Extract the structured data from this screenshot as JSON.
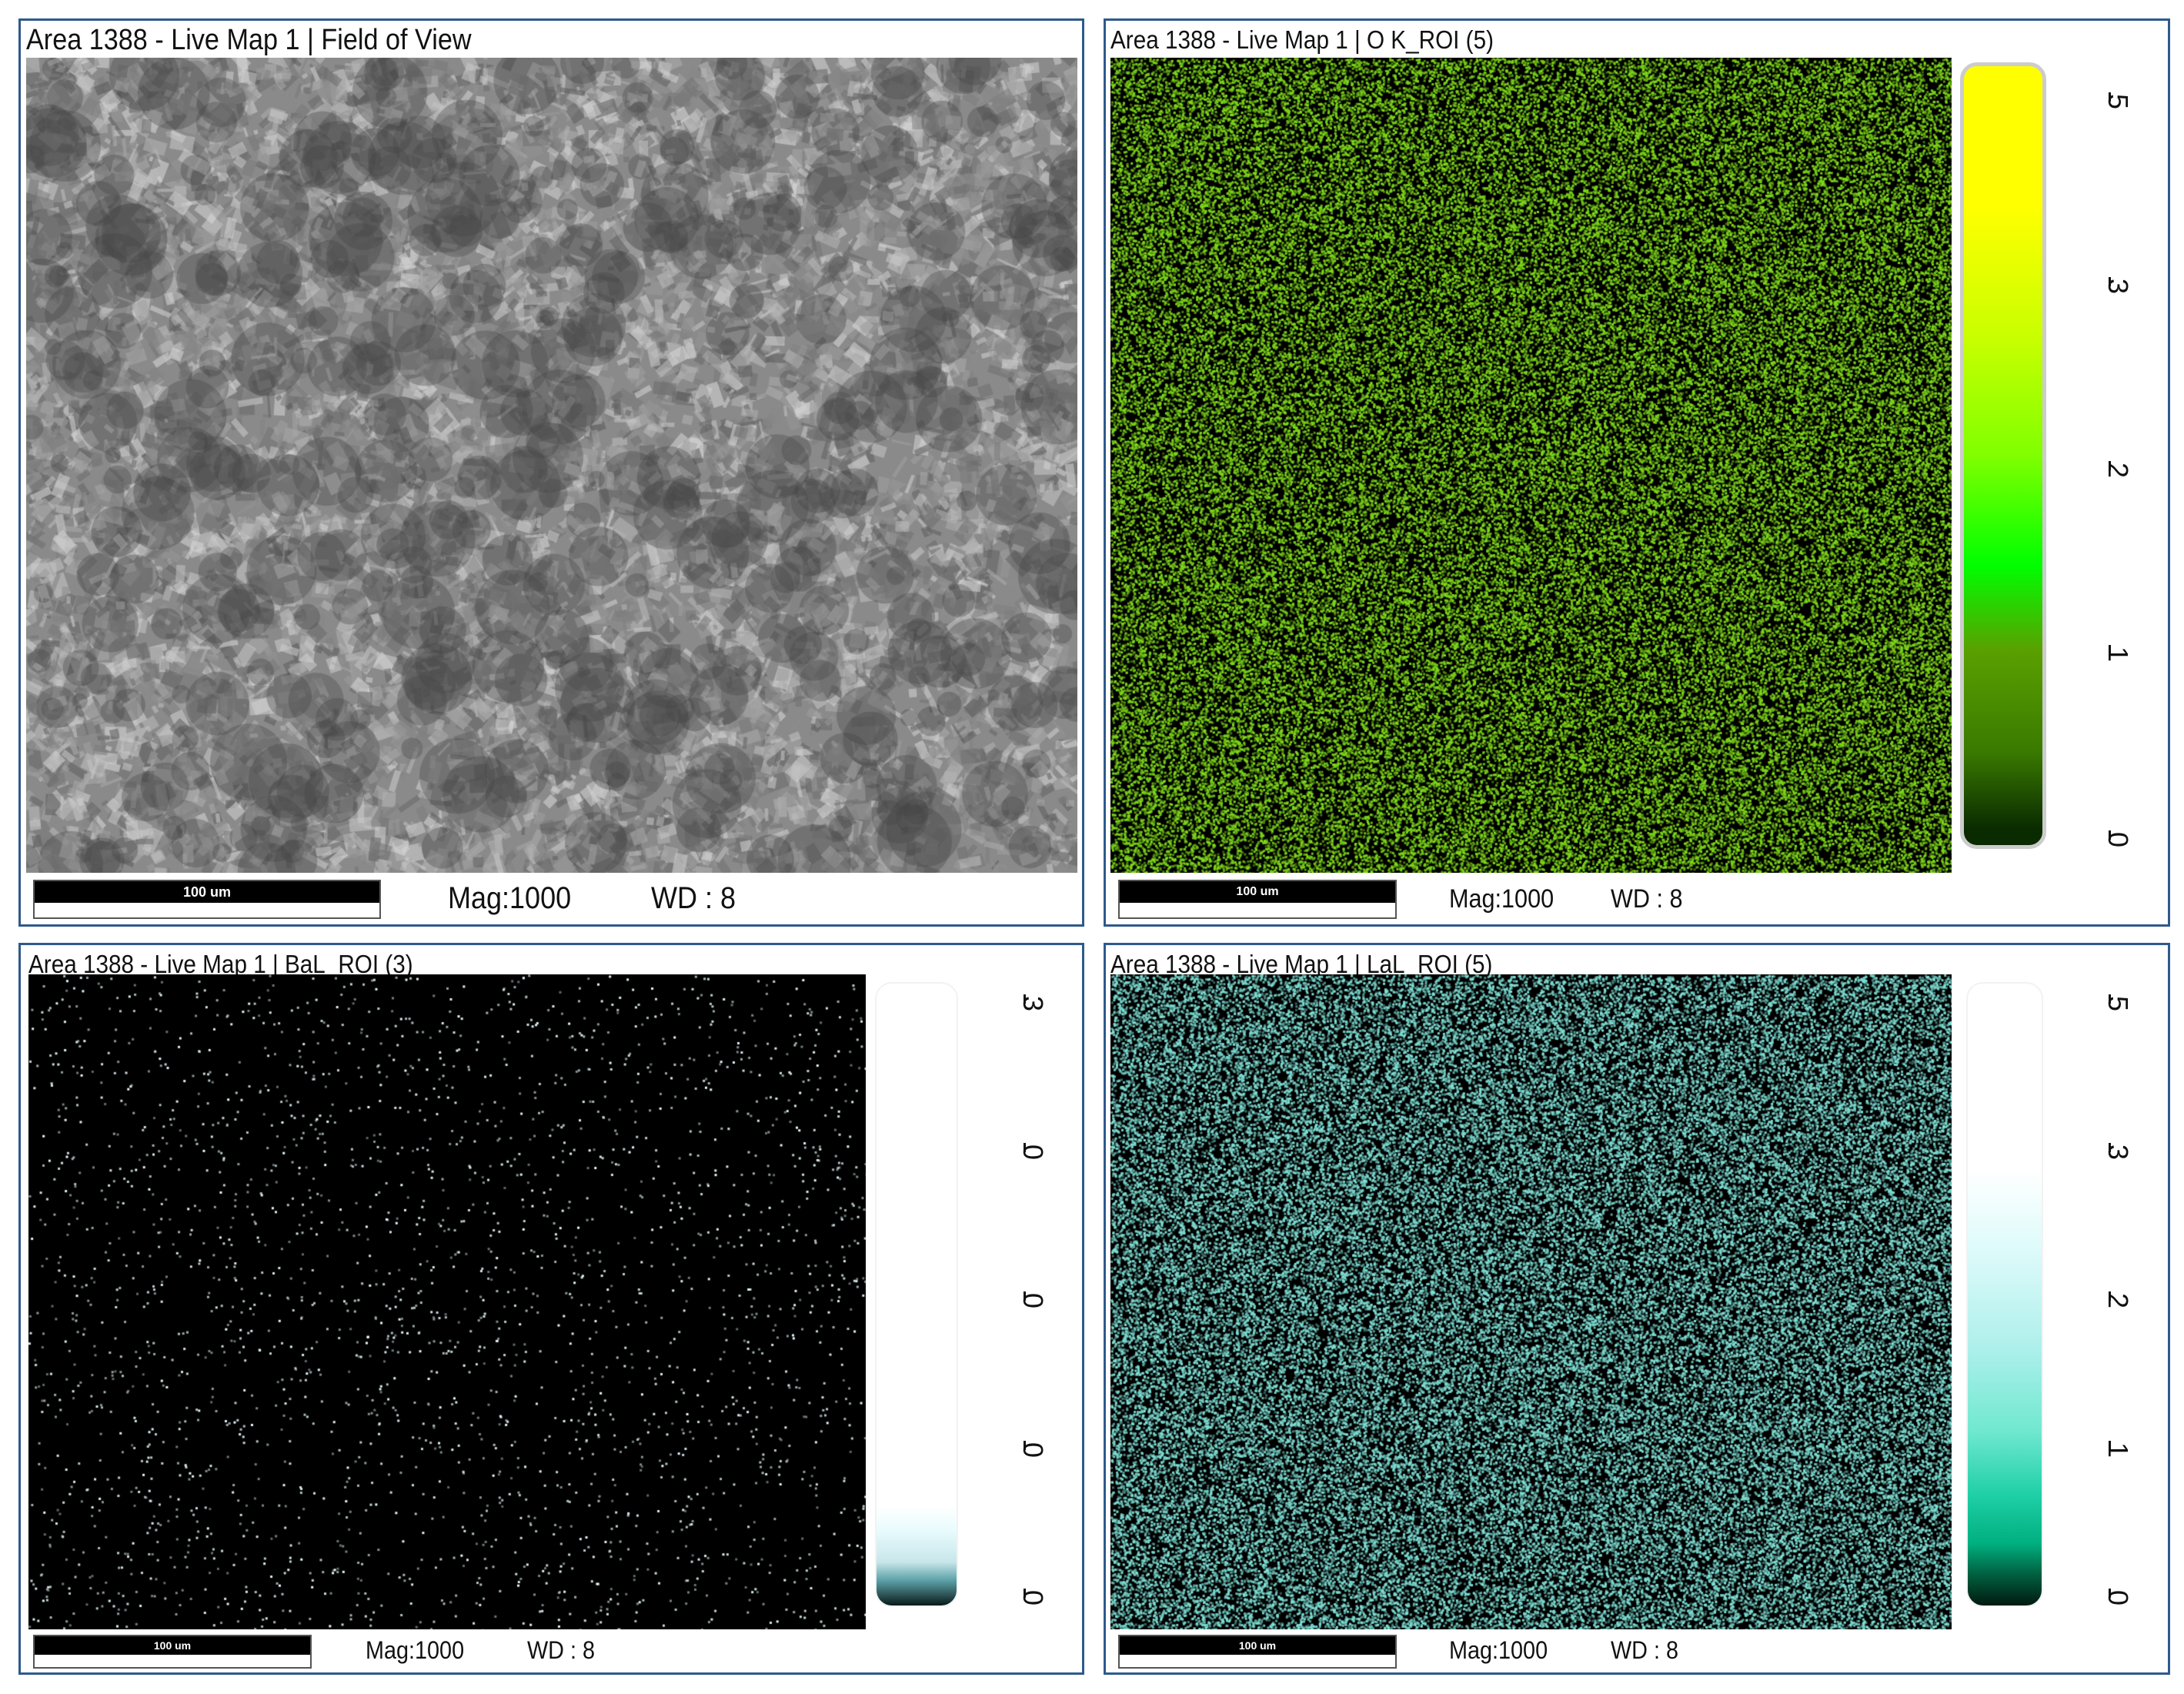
{
  "panels": [
    {
      "title": "Area 1388 - Live Map 1 | Field of View",
      "scale_label": "100 um",
      "mag": "Mag:1000",
      "wd": "WD : 8"
    },
    {
      "title": "Area 1388 - Live Map 1 | O K_ROI (5)",
      "scale_label": "100 um",
      "mag": "Mag:1000",
      "wd": "WD : 8",
      "ticks": [
        "5",
        "3",
        "2",
        "1",
        "0"
      ],
      "dot_color": "#7fd81a"
    },
    {
      "title": "Area 1388 - Live Map 1 | BaL_ROI (3)",
      "scale_label": "100 um",
      "mag": "Mag:1000",
      "wd": "WD : 8",
      "ticks": [
        "3",
        "0",
        "0",
        "0",
        "0"
      ],
      "dot_color": "#e8fbff"
    },
    {
      "title": "Area 1388 - Live Map 1 | LaL_ROI (5)",
      "scale_label": "100 um",
      "mag": "Mag:1000",
      "wd": "WD : 8",
      "ticks": [
        "5",
        "3",
        "2",
        "1",
        "0"
      ],
      "dot_color": "#7fe0d6"
    }
  ],
  "colors": {
    "border": "#2e5a8c",
    "o_map": "#7fd81a",
    "ba_map": "#e8fbff",
    "la_map": "#7fe0d6"
  }
}
